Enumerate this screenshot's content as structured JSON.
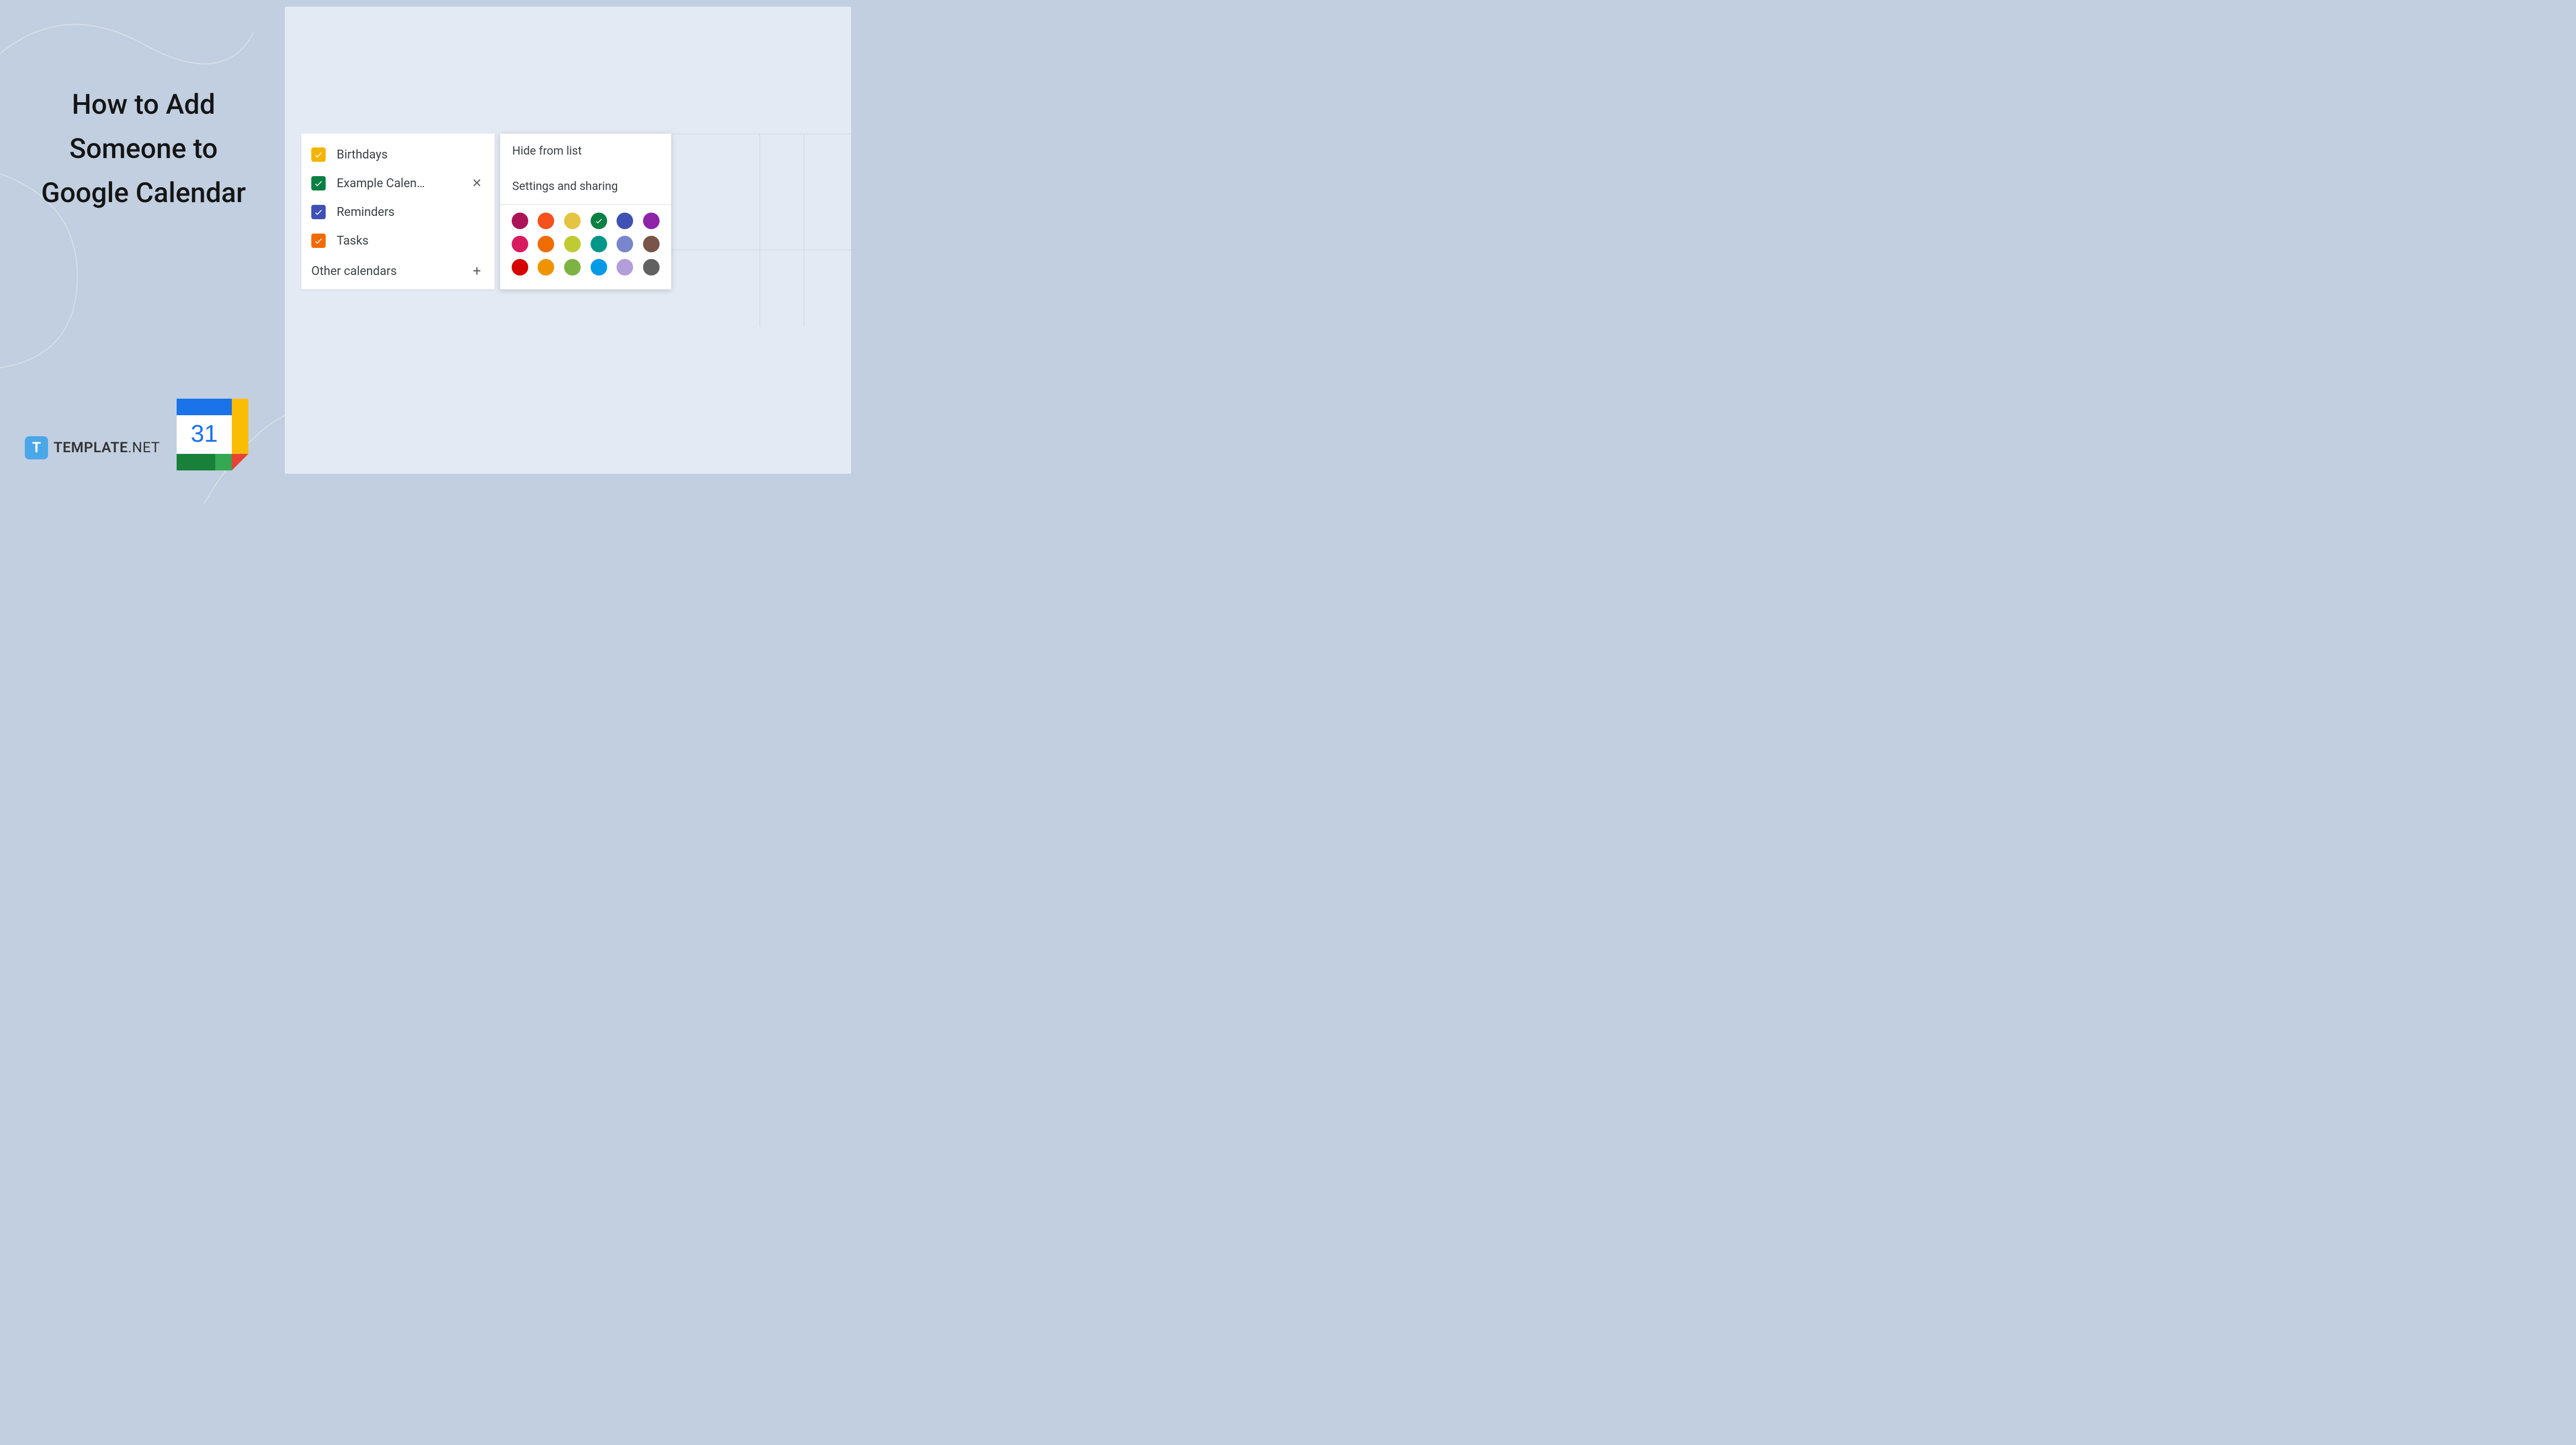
{
  "title": "How to Add Someone to Google Calendar",
  "brand": {
    "icon_letter": "T",
    "name": "TEMPLATE",
    "suffix": ".NET"
  },
  "calendar_logo_day": "31",
  "calendar_list": [
    {
      "label": "Birthdays",
      "color": "#f5b400",
      "close": false
    },
    {
      "label": "Example Calen…",
      "color": "#0b8043",
      "close": true
    },
    {
      "label": "Reminders",
      "color": "#3f51b5",
      "close": false
    },
    {
      "label": "Tasks",
      "color": "#ef6c00",
      "close": false
    }
  ],
  "other_calendars_label": "Other calendars",
  "menu": {
    "hide": "Hide from list",
    "settings": "Settings and sharing"
  },
  "swatches": [
    "#ad1457",
    "#f4511e",
    "#e4c441",
    "#0b8043",
    "#3f51b5",
    "#8e24aa",
    "#d81b60",
    "#ef6c00",
    "#c0ca33",
    "#009688",
    "#7986cb",
    "#795548",
    "#d50000",
    "#f09300",
    "#7cb342",
    "#039be5",
    "#b39ddb",
    "#616161"
  ],
  "selected_swatch_index": 3
}
